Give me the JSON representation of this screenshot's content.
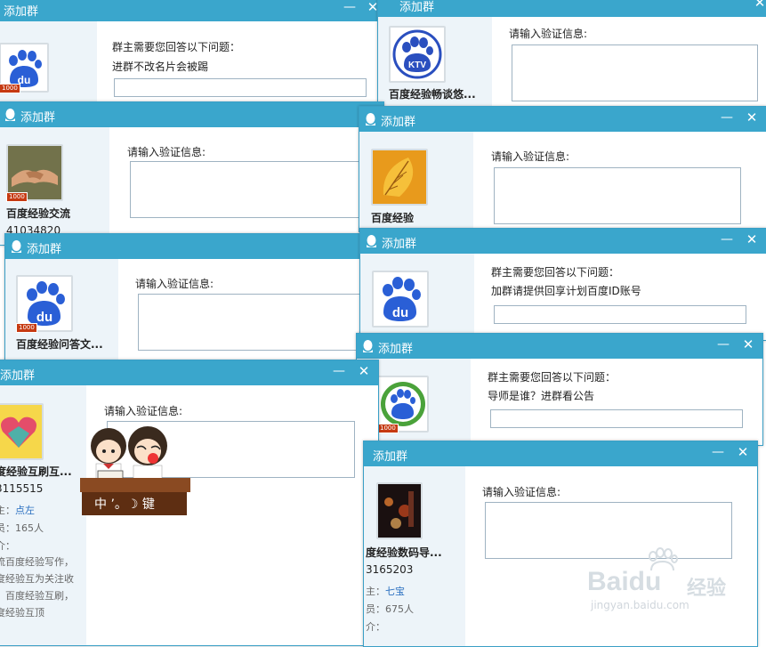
{
  "windows": [
    {
      "title": "添加群",
      "group_name": "",
      "group_number": "",
      "prompt": "群主需要您回答以下问题：",
      "answer": "进群不改名片会被踢"
    },
    {
      "title": "添加群",
      "group_name": "百度经验畅谈悠...",
      "group_number": "",
      "prompt": "请输入验证信息:",
      "answer": ""
    },
    {
      "title": "添加群",
      "group_name": "百度经验交流",
      "group_number": "41034820",
      "prompt": "请输入验证信息:",
      "answer": ""
    },
    {
      "title": "添加群",
      "group_name": "百度经验",
      "group_number": "",
      "prompt": "请输入验证信息:",
      "answer": ""
    },
    {
      "title": "添加群",
      "group_name": "百度经验问答文...",
      "group_number": "",
      "prompt": "请输入验证信息:",
      "answer": ""
    },
    {
      "title": "添加群",
      "group_name": "",
      "group_number": "",
      "prompt": "群主需要您回答以下问题：",
      "answer": "加群请提供回享计划百度ID账号"
    },
    {
      "title": "添加群",
      "group_name": "",
      "group_number": "",
      "prompt": "群主需要您回答以下问题：",
      "answer": "导师是谁？进群看公告"
    },
    {
      "title": "添加群",
      "group_name": "度经验互刷互...",
      "group_number": "3115515",
      "owner_label": "主：",
      "owner_name": "点左",
      "members": "员：165人",
      "intro_label": "介：",
      "intro": [
        "流百度经验写作，",
        "度经验互为关注收",
        "，百度经验互刷，",
        "度经验互顶"
      ],
      "prompt": "请输入验证信息:",
      "answer": ""
    },
    {
      "title": "添加群",
      "group_name": "度经验数码导...",
      "group_number": "3165203",
      "owner_label": "主：",
      "owner_name": "七宝",
      "members": "员：675人",
      "intro_label": "介：",
      "prompt": "请输入验证信息:",
      "answer": ""
    }
  ],
  "badge_text": "1000",
  "desk_sign": "中 ’。☽  键",
  "watermark": {
    "brand": "Baidu",
    "suffix": "经验",
    "url": "jingyan.baidu.com"
  },
  "controls": {
    "minimize": "—",
    "close": "✕"
  },
  "colors": {
    "titlebar": "#3aa6cc",
    "left_panel": "#edf4f9",
    "link": "#2a6fc0"
  }
}
